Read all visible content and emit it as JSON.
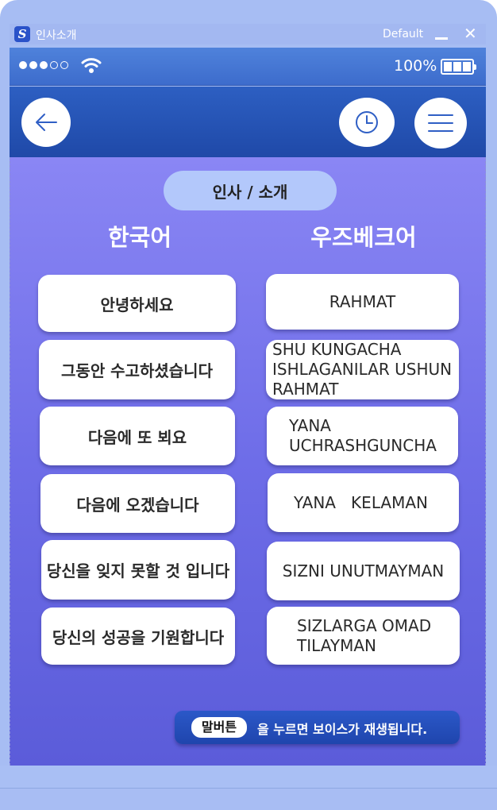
{
  "window": {
    "title": "인사소개",
    "logo_letter": "S",
    "mode": "Default",
    "minimize_symbol": "",
    "close_symbol": "✕"
  },
  "statusbar": {
    "signal_dots_on": 3,
    "signal_dots_total": 5,
    "battery_text": "100%",
    "battery_level": 1.0
  },
  "navbar": {
    "back_icon": "arrow-left-icon",
    "history_icon": "clock-icon",
    "menu_icon": "hamburger-menu-icon"
  },
  "section": {
    "title": "인사 / 소개"
  },
  "columns": {
    "korean_label": "한국어",
    "uzbek_label": "우즈베크어"
  },
  "phrases": {
    "korean": [
      "안녕하세요",
      "그동안 수고하셨습니다",
      "다음에 또 뵈요",
      "다음에 오겠습니다",
      "당신을 잊지 못할 것 입니다",
      "당신의 성공을 기원합니다"
    ],
    "uzbek": [
      "RAHMAT",
      "SHU KUNGACHA ISHLAGANILAR USHUN RAHMAT",
      "YANA UCHRASHGUNCHA",
      "YANA   KELAMAN",
      "SIZNI UNUTMAYMAN",
      "SIZLARGA OMAD TILAYMAN"
    ]
  },
  "hint": {
    "badge": "말버튼",
    "text": "을  누르면 보이스가 재생됩니다."
  },
  "colors": {
    "accent": "#2d5fc2",
    "content_top": "#8a86f4",
    "content_bottom": "#5b5cd9",
    "pill": "#b3c8fb"
  }
}
